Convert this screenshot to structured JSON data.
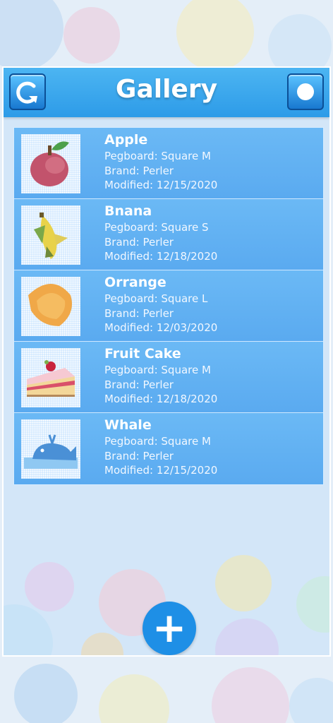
{
  "header": {
    "title": "Gallery",
    "left_icon": "refresh-icon",
    "right_icon": "record-icon"
  },
  "items": [
    {
      "name": "Apple",
      "pegboard": "Pegboard: Square M",
      "brand": "Brand: Perler",
      "modified": "Modified: 12/15/2020",
      "thumbnail": "apple-icon"
    },
    {
      "name": "Bnana",
      "pegboard": "Pegboard: Square S",
      "brand": "Brand: Perler",
      "modified": "Modified: 12/18/2020",
      "thumbnail": "banana-icon"
    },
    {
      "name": "Orrange",
      "pegboard": "Pegboard: Square L",
      "brand": "Brand: Perler",
      "modified": "Modified: 12/03/2020",
      "thumbnail": "orange-slice-icon"
    },
    {
      "name": "Fruit Cake",
      "pegboard": "Pegboard: Square M",
      "brand": "Brand: Perler",
      "modified": "Modified: 12/18/2020",
      "thumbnail": "cake-icon"
    },
    {
      "name": "Whale",
      "pegboard": "Pegboard: Square M",
      "brand": "Brand: Perler",
      "modified": "Modified: 12/15/2020",
      "thumbnail": "whale-icon"
    }
  ],
  "add_button": {
    "label": "+"
  },
  "colors": {
    "header": "#3aa8ef",
    "list_item": "#62b1f2",
    "add_button": "#1e8fe6"
  }
}
